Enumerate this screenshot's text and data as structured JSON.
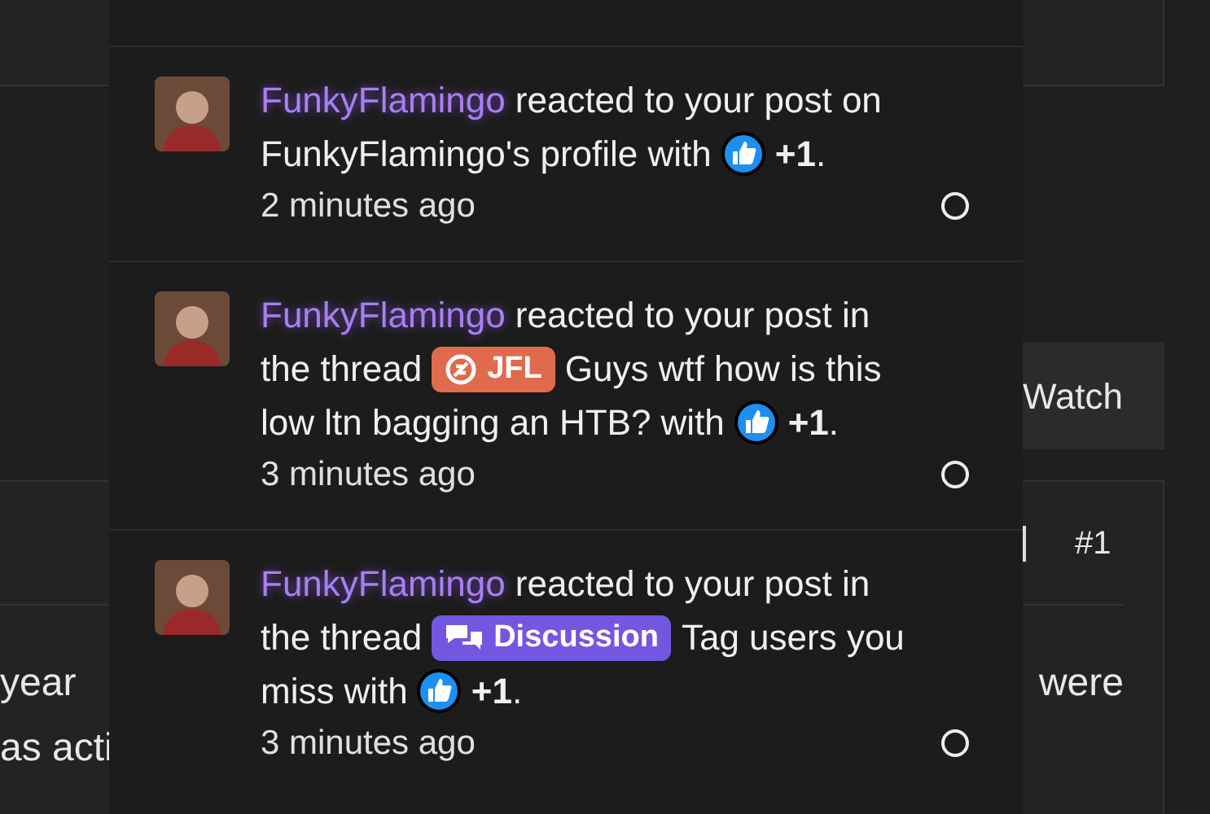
{
  "page": {
    "watch_button": "Watch",
    "post_number": "#1",
    "post_text_left": [
      "year",
      "as acti"
    ],
    "post_text_right": [
      "were"
    ]
  },
  "notifications": [
    {
      "user": "FunkyFlamingo",
      "action": "reacted to your post on",
      "object": "FunkyFlamingo's profile with",
      "reaction": "**+1**.",
      "time": "2 minutes ago",
      "read": false
    },
    {
      "user": "FunkyFlamingo",
      "action": "reacted to your post in",
      "object": "the thread",
      "prefix": {
        "label": "JFL",
        "kind": "jfl",
        "color": "#e06b4c"
      },
      "thread": [
        "Guys wtf how is this",
        "low ltn bagging an HTB?"
      ],
      "suffix": "with",
      "reaction": "**+1**.",
      "time": "3 minutes ago",
      "read": false
    },
    {
      "user": "FunkyFlamingo",
      "action": "reacted to your post in",
      "object": "the thread",
      "prefix": {
        "label": "Discussion",
        "kind": "discussion",
        "color": "#7457e0"
      },
      "thread": [
        "Tag users you",
        "miss"
      ],
      "suffix": "with",
      "reaction": "**+1**.",
      "time": "3 minutes ago",
      "read": false
    }
  ]
}
